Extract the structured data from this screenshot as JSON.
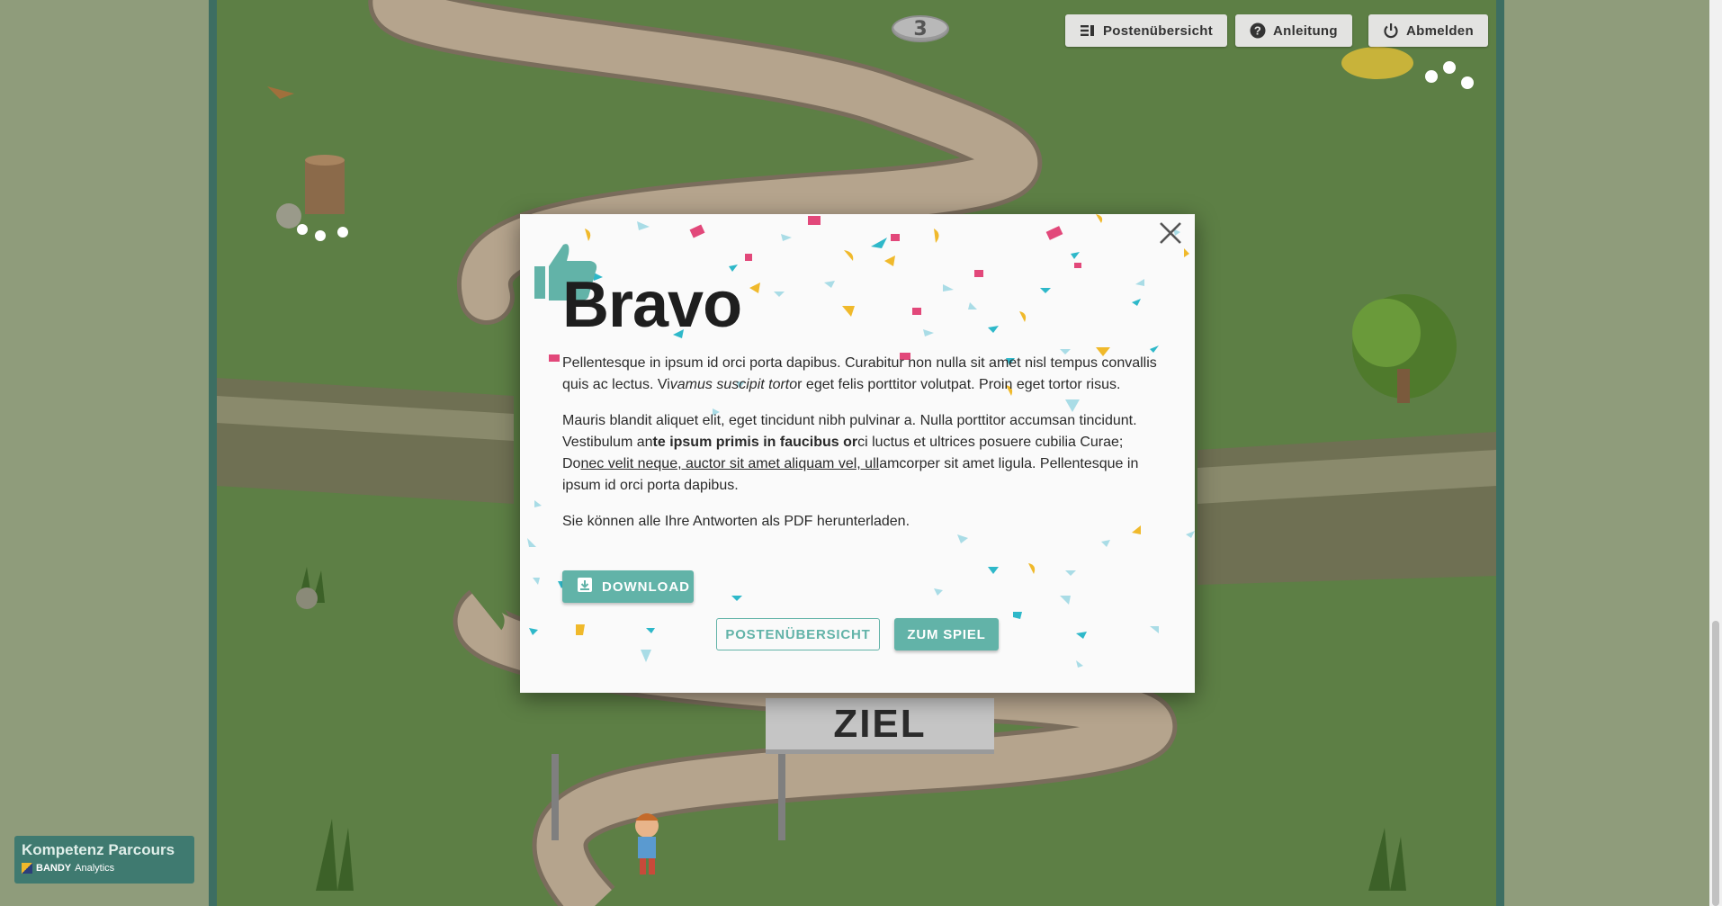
{
  "game": {
    "level_number": "3",
    "finish_sign": "ZIEL"
  },
  "toolbar": {
    "overview_label": "Postenübersicht",
    "guide_label": "Anleitung",
    "logout_label": "Abmelden"
  },
  "modal": {
    "title": "Bravo",
    "paragraph1": {
      "part1": "Pellentesque in ipsum id orci porta dapibus. Curabitur non nulla sit amet nisl tempus convallis quis ac lectus. Vi",
      "italic": "vamus suscipit torto",
      "part2": "r eget felis porttitor volutpat. Proin eget tortor risus."
    },
    "paragraph2": {
      "part1": "Mauris blandit aliquet elit, eget tincidunt nibh pulvinar a. Nulla porttitor accumsan tincidunt. Vestibulum an",
      "bold": "te ipsum primis in faucibus or",
      "part2": "ci luctus et ultrices posuere cubilia Curae; Do",
      "underline": "nec velit neque, auctor sit amet aliquam vel, ull",
      "part3": "amcorper sit amet ligula. Pellentesque in ipsum id orci porta dapibus."
    },
    "download_hint": "Sie können alle Ihre Antworten als PDF herunterladen.",
    "download_label": "DOWNLOAD",
    "overview_button_label": "POSTENÜBERSICHT",
    "play_button_label": "ZUM SPIEL"
  },
  "logo": {
    "title": "Kompetenz Parcours",
    "brand_bold": "BANDY",
    "brand_rest": "Analytics"
  },
  "colors": {
    "accent": "#62b3a8",
    "grass": "#5d7f45",
    "path": "#b5a48d",
    "confetti_pink": "#e2487a",
    "confetti_yellow": "#f0b92b",
    "confetti_cyan": "#2eb8c9",
    "confetti_light": "#a9dce6"
  },
  "icons": {
    "overview": "list-icon",
    "guide": "help-circle-icon",
    "logout": "power-icon",
    "close": "close-icon",
    "download": "download-icon",
    "thumb": "thumbs-up-icon"
  }
}
